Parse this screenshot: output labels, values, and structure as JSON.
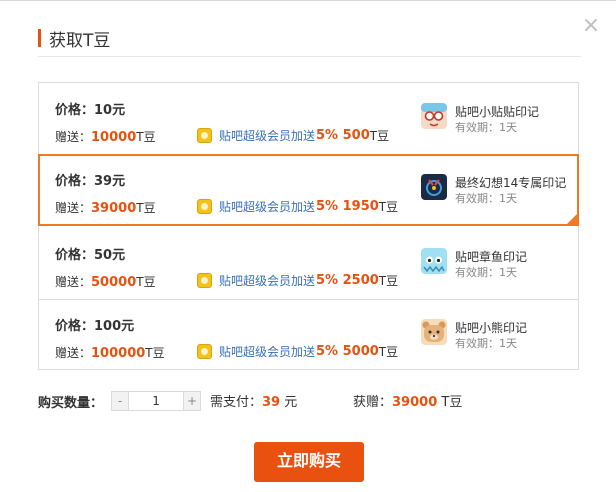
{
  "dialog": {
    "title": "获取T豆",
    "close_label": "×"
  },
  "packages": [
    {
      "price_label": "价格：10元",
      "gift_prefix": "赠送：",
      "gift_amount": "10000",
      "gift_unit": "T豆",
      "vip_text": "贴吧超级会员加送",
      "vip_percent": "5% 500",
      "vip_unit": "T豆",
      "badge_name": "贴吧小贴贴印记",
      "badge_valid": "有效期：1天",
      "badge_icon": "badge-tiebie-icon",
      "selected": false
    },
    {
      "price_label": "价格：39元",
      "gift_prefix": "赠送：",
      "gift_amount": "39000",
      "gift_unit": "T豆",
      "vip_text": "贴吧超级会员加送",
      "vip_percent": "5% 1950",
      "vip_unit": "T豆",
      "badge_name": "最终幻想14专属印记",
      "badge_valid": "有效期：1天",
      "badge_icon": "badge-ff14-icon",
      "selected": true
    },
    {
      "price_label": "价格：50元",
      "gift_prefix": "赠送：",
      "gift_amount": "50000",
      "gift_unit": "T豆",
      "vip_text": "贴吧超级会员加送",
      "vip_percent": "5% 2500",
      "vip_unit": "T豆",
      "badge_name": "贴吧章鱼印记",
      "badge_valid": "有效期：1天",
      "badge_icon": "badge-octopus-icon",
      "selected": false
    },
    {
      "price_label": "价格：100元",
      "gift_prefix": "赠送：",
      "gift_amount": "100000",
      "gift_unit": "T豆",
      "vip_text": "贴吧超级会员加送",
      "vip_percent": "5% 5000",
      "vip_unit": "T豆",
      "badge_name": "贴吧小熊印记",
      "badge_valid": "有效期：1天",
      "badge_icon": "badge-bear-icon",
      "selected": false
    }
  ],
  "quantity": {
    "label": "购买数量：",
    "minus": "-",
    "plus": "+",
    "value": "1"
  },
  "payment": {
    "pay_prefix": "需支付：",
    "pay_amount": "39",
    "pay_unit": "元",
    "gain_prefix": "获赠：",
    "gain_amount": "39000",
    "gain_unit": "T豆"
  },
  "buy_button": "立即购买",
  "colors": {
    "accent": "#e8510f",
    "selected_border": "#ef7a24",
    "link": "#3a6fb8"
  }
}
